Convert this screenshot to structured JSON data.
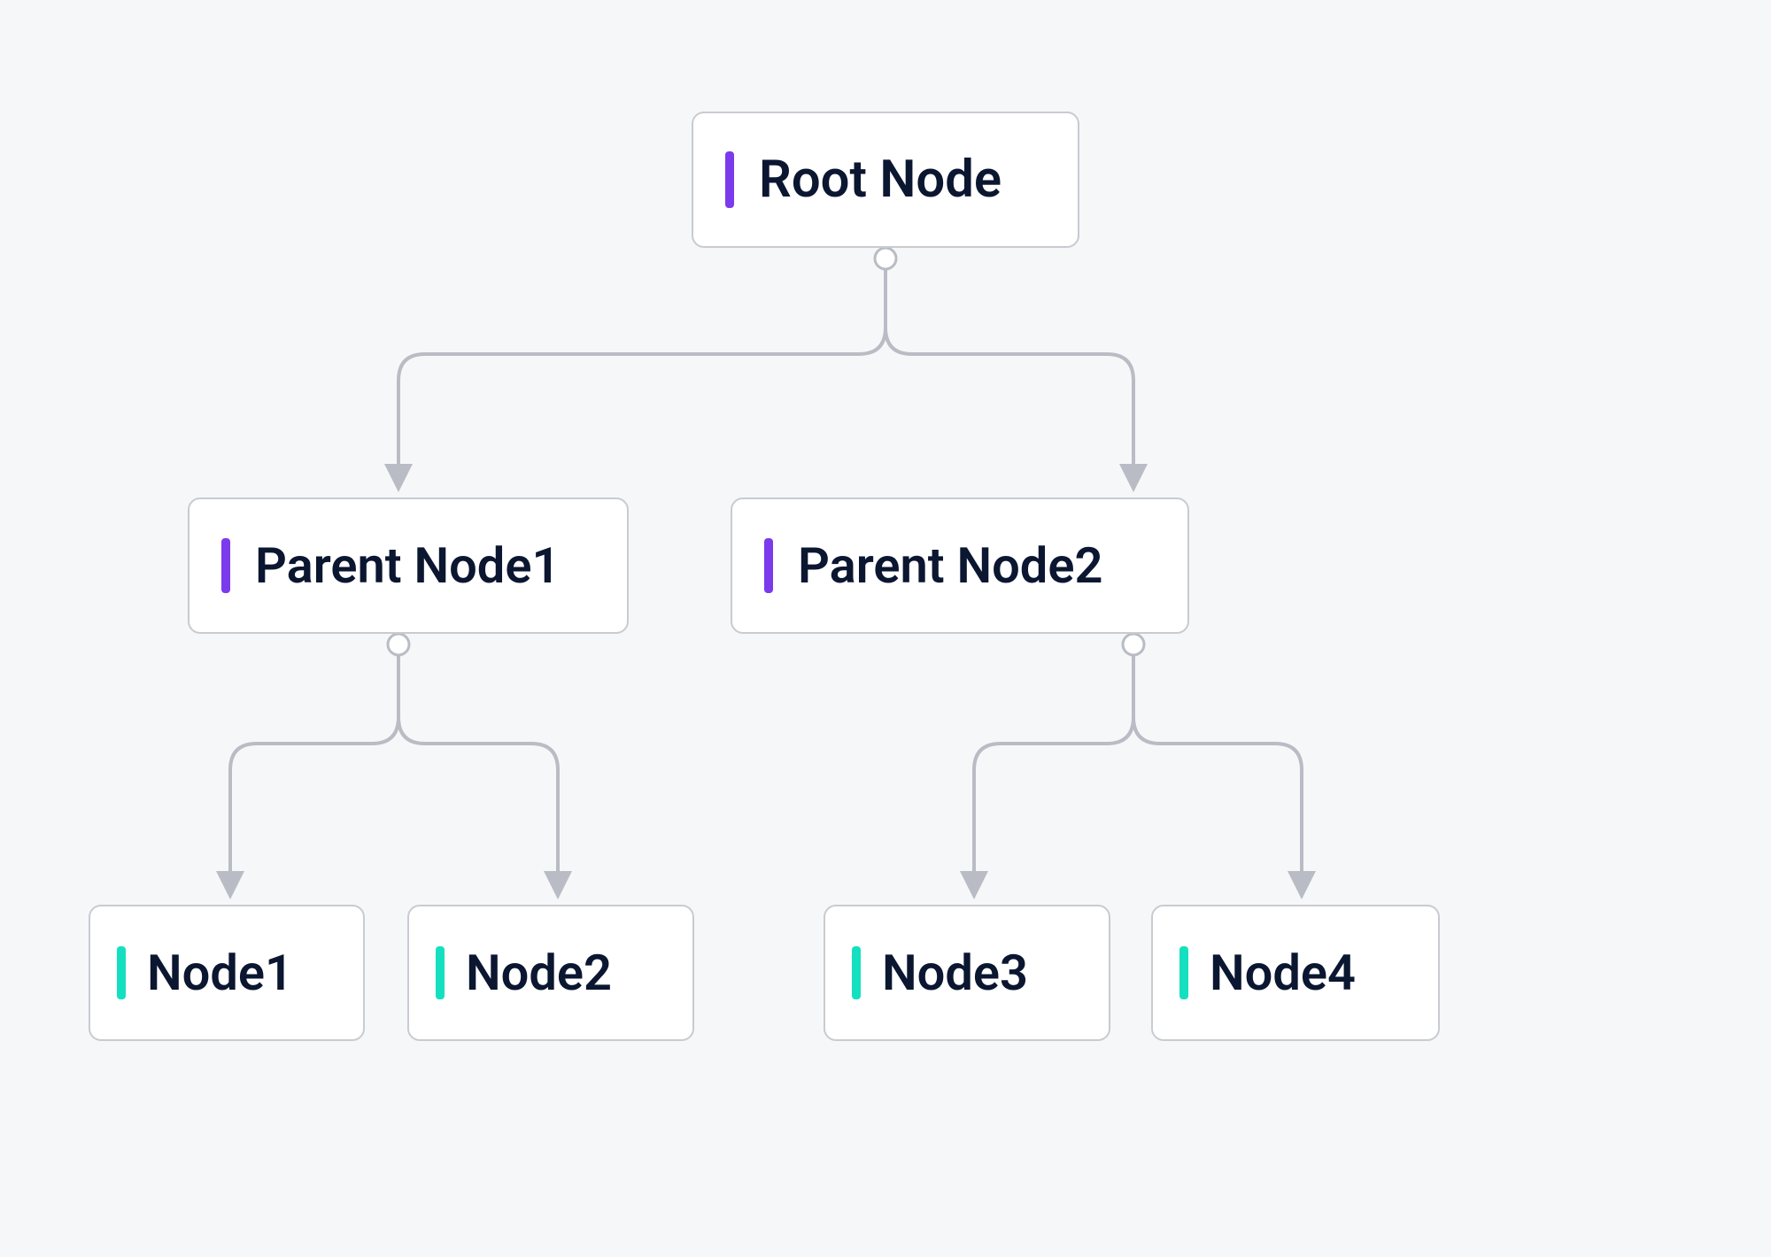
{
  "tree": {
    "root": {
      "label": "Root Node",
      "accent": "purple"
    },
    "parents": [
      {
        "label": "Parent Node1",
        "accent": "purple"
      },
      {
        "label": "Parent Node2",
        "accent": "purple"
      }
    ],
    "leaves": [
      {
        "label": "Node1",
        "accent": "teal"
      },
      {
        "label": "Node2",
        "accent": "teal"
      },
      {
        "label": "Node3",
        "accent": "teal"
      },
      {
        "label": "Node4",
        "accent": "teal"
      }
    ]
  },
  "colors": {
    "node_border": "#c8cbd1",
    "connector": "#b9bcc4",
    "accent_purple": "#7c3aed",
    "accent_teal": "#14e0c0",
    "text": "#0b1630",
    "background": "#f6f7f8"
  }
}
